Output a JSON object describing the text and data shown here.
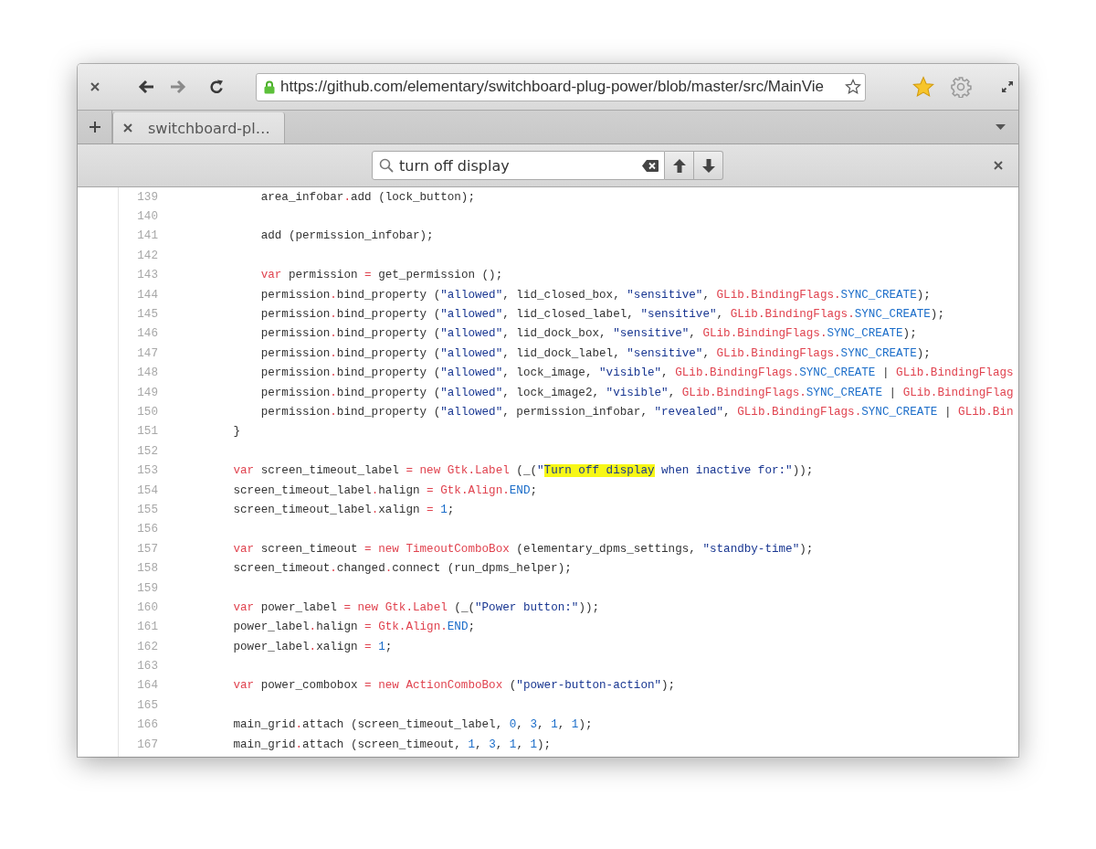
{
  "window": {
    "url": "https://github.com/elementary/switchboard-plug-power/blob/master/src/MainVie"
  },
  "tabs": [
    {
      "title": "switchboard-pl…",
      "selected": true
    }
  ],
  "find_bar": {
    "query": "turn off display"
  },
  "code": {
    "lines": [
      {
        "number": "139",
        "tokens": [
          {
            "kind": "plain",
            "text": "            area_infobar"
          },
          {
            "kind": "keyword",
            "text": "."
          },
          {
            "kind": "plain",
            "text": "add (lock_button);"
          }
        ]
      },
      {
        "number": "140"
      },
      {
        "number": "141",
        "tokens": [
          {
            "kind": "plain",
            "text": "            add (permission_infobar);"
          }
        ]
      },
      {
        "number": "142"
      },
      {
        "number": "143",
        "tokens": [
          {
            "kind": "keyword",
            "text": "            var"
          },
          {
            "kind": "plain",
            "text": " permission "
          },
          {
            "kind": "keyword",
            "text": "="
          },
          {
            "kind": "plain",
            "text": " get_permission ();"
          }
        ]
      },
      {
        "number": "144",
        "tokens": [
          {
            "kind": "plain",
            "text": "            permission"
          },
          {
            "kind": "keyword",
            "text": "."
          },
          {
            "kind": "plain",
            "text": "bind_property ("
          },
          {
            "kind": "string",
            "text": "\"allowed\""
          },
          {
            "kind": "plain",
            "text": ", lid_closed_box, "
          },
          {
            "kind": "string",
            "text": "\"sensitive\""
          },
          {
            "kind": "plain",
            "text": ", "
          },
          {
            "kind": "keyword",
            "text": "GLib.BindingFlags."
          },
          {
            "kind": "constant",
            "text": "SYNC_CREATE"
          },
          {
            "kind": "plain",
            "text": ");"
          }
        ]
      },
      {
        "number": "145",
        "tokens": [
          {
            "kind": "plain",
            "text": "            permission"
          },
          {
            "kind": "keyword",
            "text": "."
          },
          {
            "kind": "plain",
            "text": "bind_property ("
          },
          {
            "kind": "string",
            "text": "\"allowed\""
          },
          {
            "kind": "plain",
            "text": ", lid_closed_label, "
          },
          {
            "kind": "string",
            "text": "\"sensitive\""
          },
          {
            "kind": "plain",
            "text": ", "
          },
          {
            "kind": "keyword",
            "text": "GLib.BindingFlags."
          },
          {
            "kind": "constant",
            "text": "SYNC_CREATE"
          },
          {
            "kind": "plain",
            "text": ");"
          }
        ]
      },
      {
        "number": "146",
        "tokens": [
          {
            "kind": "plain",
            "text": "            permission"
          },
          {
            "kind": "keyword",
            "text": "."
          },
          {
            "kind": "plain",
            "text": "bind_property ("
          },
          {
            "kind": "string",
            "text": "\"allowed\""
          },
          {
            "kind": "plain",
            "text": ", lid_dock_box, "
          },
          {
            "kind": "string",
            "text": "\"sensitive\""
          },
          {
            "kind": "plain",
            "text": ", "
          },
          {
            "kind": "keyword",
            "text": "GLib.BindingFlags."
          },
          {
            "kind": "constant",
            "text": "SYNC_CREATE"
          },
          {
            "kind": "plain",
            "text": ");"
          }
        ]
      },
      {
        "number": "147",
        "tokens": [
          {
            "kind": "plain",
            "text": "            permission"
          },
          {
            "kind": "keyword",
            "text": "."
          },
          {
            "kind": "plain",
            "text": "bind_property ("
          },
          {
            "kind": "string",
            "text": "\"allowed\""
          },
          {
            "kind": "plain",
            "text": ", lid_dock_label, "
          },
          {
            "kind": "string",
            "text": "\"sensitive\""
          },
          {
            "kind": "plain",
            "text": ", "
          },
          {
            "kind": "keyword",
            "text": "GLib.BindingFlags."
          },
          {
            "kind": "constant",
            "text": "SYNC_CREATE"
          },
          {
            "kind": "plain",
            "text": ");"
          }
        ]
      },
      {
        "number": "148",
        "tokens": [
          {
            "kind": "plain",
            "text": "            permission"
          },
          {
            "kind": "keyword",
            "text": "."
          },
          {
            "kind": "plain",
            "text": "bind_property ("
          },
          {
            "kind": "string",
            "text": "\"allowed\""
          },
          {
            "kind": "plain",
            "text": ", lock_image, "
          },
          {
            "kind": "string",
            "text": "\"visible\""
          },
          {
            "kind": "plain",
            "text": ", "
          },
          {
            "kind": "keyword",
            "text": "GLib.BindingFlags."
          },
          {
            "kind": "constant",
            "text": "SYNC_CREATE"
          },
          {
            "kind": "plain",
            "text": " | "
          },
          {
            "kind": "keyword",
            "text": "GLib.BindingFlags"
          }
        ]
      },
      {
        "number": "149",
        "tokens": [
          {
            "kind": "plain",
            "text": "            permission"
          },
          {
            "kind": "keyword",
            "text": "."
          },
          {
            "kind": "plain",
            "text": "bind_property ("
          },
          {
            "kind": "string",
            "text": "\"allowed\""
          },
          {
            "kind": "plain",
            "text": ", lock_image2, "
          },
          {
            "kind": "string",
            "text": "\"visible\""
          },
          {
            "kind": "plain",
            "text": ", "
          },
          {
            "kind": "keyword",
            "text": "GLib.BindingFlags."
          },
          {
            "kind": "constant",
            "text": "SYNC_CREATE"
          },
          {
            "kind": "plain",
            "text": " | "
          },
          {
            "kind": "keyword",
            "text": "GLib.BindingFlag"
          }
        ]
      },
      {
        "number": "150",
        "tokens": [
          {
            "kind": "plain",
            "text": "            permission"
          },
          {
            "kind": "keyword",
            "text": "."
          },
          {
            "kind": "plain",
            "text": "bind_property ("
          },
          {
            "kind": "string",
            "text": "\"allowed\""
          },
          {
            "kind": "plain",
            "text": ", permission_infobar, "
          },
          {
            "kind": "string",
            "text": "\"revealed\""
          },
          {
            "kind": "plain",
            "text": ", "
          },
          {
            "kind": "keyword",
            "text": "GLib.BindingFlags."
          },
          {
            "kind": "constant",
            "text": "SYNC_CREATE"
          },
          {
            "kind": "plain",
            "text": " | "
          },
          {
            "kind": "keyword",
            "text": "GLib.Bin"
          }
        ]
      },
      {
        "number": "151",
        "tokens": [
          {
            "kind": "plain",
            "text": "        }"
          }
        ]
      },
      {
        "number": "152"
      },
      {
        "number": "153",
        "tokens": [
          {
            "kind": "keyword",
            "text": "        var"
          },
          {
            "kind": "plain",
            "text": " screen_timeout_label "
          },
          {
            "kind": "keyword",
            "text": "= new Gtk.Label"
          },
          {
            "kind": "plain",
            "text": " (_("
          },
          {
            "kind": "string",
            "text": "\""
          },
          {
            "kind": "match",
            "text": "Turn off display"
          },
          {
            "kind": "string",
            "text": " when inactive for:\""
          },
          {
            "kind": "plain",
            "text": "));"
          }
        ]
      },
      {
        "number": "154",
        "tokens": [
          {
            "kind": "plain",
            "text": "        screen_timeout_label"
          },
          {
            "kind": "keyword",
            "text": "."
          },
          {
            "kind": "plain",
            "text": "halign "
          },
          {
            "kind": "keyword",
            "text": "= Gtk.Align."
          },
          {
            "kind": "constant",
            "text": "END"
          },
          {
            "kind": "plain",
            "text": ";"
          }
        ]
      },
      {
        "number": "155",
        "tokens": [
          {
            "kind": "plain",
            "text": "        screen_timeout_label"
          },
          {
            "kind": "keyword",
            "text": "."
          },
          {
            "kind": "plain",
            "text": "xalign "
          },
          {
            "kind": "keyword",
            "text": "="
          },
          {
            "kind": "constant",
            "text": " 1"
          },
          {
            "kind": "plain",
            "text": ";"
          }
        ]
      },
      {
        "number": "156"
      },
      {
        "number": "157",
        "tokens": [
          {
            "kind": "keyword",
            "text": "        var"
          },
          {
            "kind": "plain",
            "text": " screen_timeout "
          },
          {
            "kind": "keyword",
            "text": "= new TimeoutComboBox"
          },
          {
            "kind": "plain",
            "text": " (elementary_dpms_settings, "
          },
          {
            "kind": "string",
            "text": "\"standby-time\""
          },
          {
            "kind": "plain",
            "text": ");"
          }
        ]
      },
      {
        "number": "158",
        "tokens": [
          {
            "kind": "plain",
            "text": "        screen_timeout"
          },
          {
            "kind": "keyword",
            "text": "."
          },
          {
            "kind": "plain",
            "text": "changed"
          },
          {
            "kind": "keyword",
            "text": "."
          },
          {
            "kind": "plain",
            "text": "connect (run_dpms_helper);"
          }
        ]
      },
      {
        "number": "159"
      },
      {
        "number": "160",
        "tokens": [
          {
            "kind": "keyword",
            "text": "        var"
          },
          {
            "kind": "plain",
            "text": " power_label "
          },
          {
            "kind": "keyword",
            "text": "= new Gtk.Label"
          },
          {
            "kind": "plain",
            "text": " (_("
          },
          {
            "kind": "string",
            "text": "\"Power button:\""
          },
          {
            "kind": "plain",
            "text": "));"
          }
        ]
      },
      {
        "number": "161",
        "tokens": [
          {
            "kind": "plain",
            "text": "        power_label"
          },
          {
            "kind": "keyword",
            "text": "."
          },
          {
            "kind": "plain",
            "text": "halign "
          },
          {
            "kind": "keyword",
            "text": "= Gtk.Align."
          },
          {
            "kind": "constant",
            "text": "END"
          },
          {
            "kind": "plain",
            "text": ";"
          }
        ]
      },
      {
        "number": "162",
        "tokens": [
          {
            "kind": "plain",
            "text": "        power_label"
          },
          {
            "kind": "keyword",
            "text": "."
          },
          {
            "kind": "plain",
            "text": "xalign "
          },
          {
            "kind": "keyword",
            "text": "="
          },
          {
            "kind": "constant",
            "text": " 1"
          },
          {
            "kind": "plain",
            "text": ";"
          }
        ]
      },
      {
        "number": "163"
      },
      {
        "number": "164",
        "tokens": [
          {
            "kind": "keyword",
            "text": "        var"
          },
          {
            "kind": "plain",
            "text": " power_combobox "
          },
          {
            "kind": "keyword",
            "text": "= new ActionComboBox"
          },
          {
            "kind": "plain",
            "text": " ("
          },
          {
            "kind": "string",
            "text": "\"power-button-action\""
          },
          {
            "kind": "plain",
            "text": ");"
          }
        ]
      },
      {
        "number": "165"
      },
      {
        "number": "166",
        "tokens": [
          {
            "kind": "plain",
            "text": "        main_grid"
          },
          {
            "kind": "keyword",
            "text": "."
          },
          {
            "kind": "plain",
            "text": "attach (screen_timeout_label, "
          },
          {
            "kind": "constant",
            "text": "0"
          },
          {
            "kind": "plain",
            "text": ", "
          },
          {
            "kind": "constant",
            "text": "3"
          },
          {
            "kind": "plain",
            "text": ", "
          },
          {
            "kind": "constant",
            "text": "1"
          },
          {
            "kind": "plain",
            "text": ", "
          },
          {
            "kind": "constant",
            "text": "1"
          },
          {
            "kind": "plain",
            "text": ");"
          }
        ]
      },
      {
        "number": "167",
        "tokens": [
          {
            "kind": "plain",
            "text": "        main_grid"
          },
          {
            "kind": "keyword",
            "text": "."
          },
          {
            "kind": "plain",
            "text": "attach (screen_timeout, "
          },
          {
            "kind": "constant",
            "text": "1"
          },
          {
            "kind": "plain",
            "text": ", "
          },
          {
            "kind": "constant",
            "text": "3"
          },
          {
            "kind": "plain",
            "text": ", "
          },
          {
            "kind": "constant",
            "text": "1"
          },
          {
            "kind": "plain",
            "text": ", "
          },
          {
            "kind": "constant",
            "text": "1"
          },
          {
            "kind": "plain",
            "text": ");"
          }
        ]
      }
    ]
  }
}
